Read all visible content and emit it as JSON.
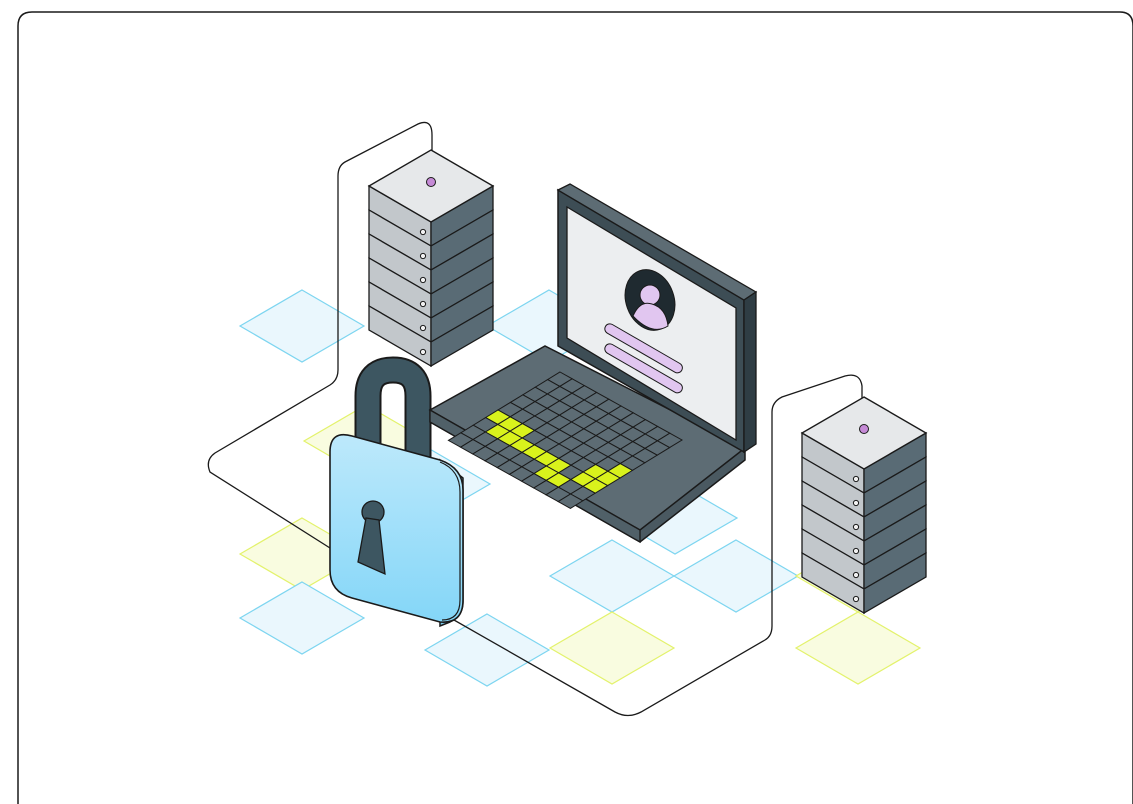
{
  "illustration": {
    "subject": "",
    "elements": {
      "server_left": "server-rack-icon",
      "server_right": "server-rack-icon",
      "laptop": "laptop-icon",
      "profile": "user-avatar-icon",
      "padlock": "padlock-icon",
      "keyhole": "keyhole-icon"
    }
  },
  "colors": {
    "outline": "#1a1a1a",
    "server_top": "#e6e8ea",
    "server_front": "#c2c7cb",
    "server_side": "#596b75",
    "laptop_body": "#5d6c74",
    "laptop_screen": "#eceef0",
    "key_dark": "#5d6c74",
    "key_bright": "#d9f21c",
    "profile_accent": "#e1c6f0",
    "lock_body_light": "#bde9fb",
    "lock_body": "#84d6f8",
    "lock_shackle": "#3d5661",
    "tile_blue": "#7dd5f0",
    "tile_yellow": "#e3f26c",
    "led": "#c58ad6"
  }
}
